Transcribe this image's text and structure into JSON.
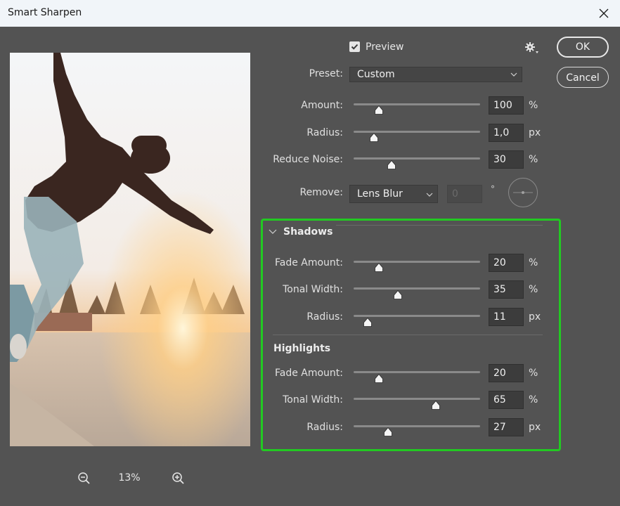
{
  "window": {
    "title": "Smart Sharpen"
  },
  "preview": {
    "label": "Preview",
    "checked": true
  },
  "buttons": {
    "ok": "OK",
    "cancel": "Cancel"
  },
  "zoom": {
    "level": "13%"
  },
  "preset": {
    "label": "Preset:",
    "value": "Custom"
  },
  "main_sliders": [
    {
      "label": "Amount:",
      "value": "100",
      "unit": "%",
      "fraction": 0.2
    },
    {
      "label": "Radius:",
      "value": "1,0",
      "unit": "px",
      "fraction": 0.16
    },
    {
      "label": "Reduce Noise:",
      "value": "30",
      "unit": "%",
      "fraction": 0.3
    }
  ],
  "remove": {
    "label": "Remove:",
    "value": "Lens Blur",
    "angle_value": "0",
    "degree_symbol": "°"
  },
  "shadows": {
    "title": "Shadows",
    "sliders": [
      {
        "label": "Fade Amount:",
        "value": "20",
        "unit": "%",
        "fraction": 0.2
      },
      {
        "label": "Tonal Width:",
        "value": "35",
        "unit": "%",
        "fraction": 0.35
      },
      {
        "label": "Radius:",
        "value": "11",
        "unit": "px",
        "fraction": 0.11
      }
    ]
  },
  "highlights": {
    "title": "Highlights",
    "sliders": [
      {
        "label": "Fade Amount:",
        "value": "20",
        "unit": "%",
        "fraction": 0.2
      },
      {
        "label": "Tonal Width:",
        "value": "65",
        "unit": "%",
        "fraction": 0.65
      },
      {
        "label": "Radius:",
        "value": "27",
        "unit": "px",
        "fraction": 0.27
      }
    ]
  },
  "colors": {
    "highlight_border": "#22c922",
    "panel_bg": "#535353"
  },
  "icons": [
    "close-icon",
    "checkmark-icon",
    "gear-icon",
    "chevron-down-icon",
    "zoom-out-icon",
    "zoom-in-icon",
    "angle-dial-icon",
    "collapse-triangle-icon"
  ]
}
